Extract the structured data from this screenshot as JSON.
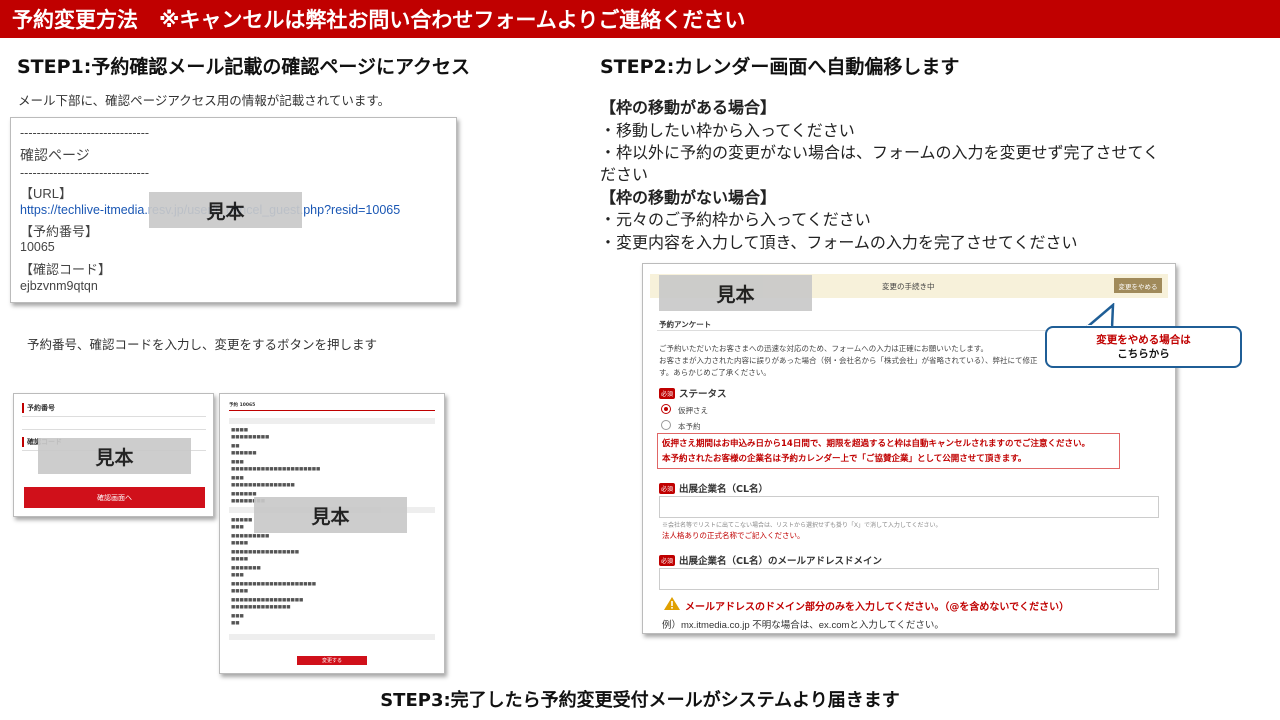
{
  "header": {
    "title": "予約変更方法　※キャンセルは弊社お問い合わせフォームよりご連絡ください"
  },
  "sample_label": "見本",
  "step1": {
    "title": "STEP1:予約確認メール記載の確認ページにアクセス",
    "note": "メール下部に、確認ページアクセス用の情報が記載されています。",
    "email": {
      "dashes": "-------------------------------",
      "confirm_page": "確認ページ",
      "url_label": "【URL】",
      "url": "https://techlive-itmedia.resv.jp/user/r_cancel_guest.php?resid=10065",
      "resv_no_label": "【予約番号】",
      "resv_no": "10065",
      "code_label": "【確認コード】",
      "code": "ejbzvnm9qtqn"
    },
    "note2": "予約番号、確認コードを入力し、変更をするボタンを押します",
    "form": {
      "label1": "予約番号",
      "label2": "確認コード",
      "button": "確認画面へ"
    },
    "detail": {
      "title": "予約 10065",
      "button": "変更する"
    }
  },
  "step2": {
    "title": "STEP2:カレンダー画面へ自動偏移します",
    "case1_head": "【枠の移動がある場合】",
    "case1_line1": "・移動したい枠から入ってください",
    "case1_line2": "・枠以外に予約の変更がない場合は、フォームの入力を変更せず完了させてく",
    "case1_line3": "ださい",
    "case2_head": "【枠の移動がない場合】",
    "case2_line1": "・元々のご予約枠から入ってください",
    "case2_line2": "・変更内容を入力して頂き、フォームの入力を完了させてください",
    "form": {
      "status_bar": "変更の手続き中",
      "stop_button": "変更をやめる",
      "section": "予約アンケート",
      "intro1": "ご予約いただいたお客さまへの迅速な対応のため、フォームへの入力は正確にお願いいたします。",
      "intro2": "お客さまが入力された内容に誤りがあった場合（例・会社名から「株式会社」が省略されている）、弊社にて修正",
      "intro3": "す。あらかじめご了承ください。",
      "required": "必須",
      "status_head": "ステータス",
      "opt1": "仮押さえ",
      "opt2": "本予約",
      "warn1": "仮押さえ期間はお申込み日から14日間で、期限を超過すると枠は自動キャンセルされますのでご注意ください。",
      "warn2": "本予約されたお客様の企業名は予約カレンダー上で「ご協賛企業」として公開させて頂きます。",
      "field1_head": "出展企業名（CL名）",
      "field1_note1": "※会社名等でリストに出てこない場合は、リストから選択せずも掛り「X」で消して入力してください。",
      "field1_note2": "法人格ありの正式名称でご記入ください。",
      "field2_head": "出展企業名（CL名）のメールアドレスドメイン",
      "field2_warn": "メールアドレスのドメイン部分のみを入力してください。（@を含めないでください）",
      "field2_example": "例）mx.itmedia.co.jp 不明な場合は、ex.comと入力してください。"
    },
    "callout": {
      "line1": "変更をやめる場合は",
      "line2": "こちらから"
    }
  },
  "step3": {
    "title": "STEP3:完了したら予約変更受付メールがシステムより届きます"
  },
  "colors": {
    "header": "#c00000",
    "accent_red": "#c00000",
    "callout_border": "#1f5e96"
  }
}
